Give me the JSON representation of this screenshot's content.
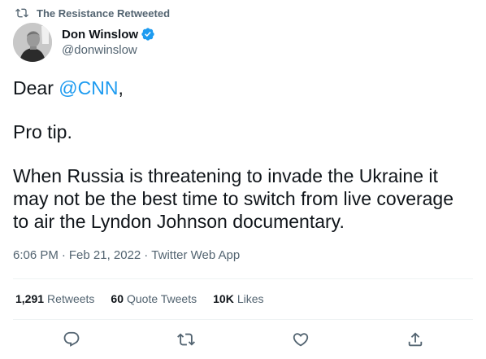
{
  "retweet_banner": {
    "icon": "retweet-icon",
    "text": "The Resistance Retweeted"
  },
  "author": {
    "avatar": "avatar-photo",
    "name": "Don Winslow",
    "verified_icon": "verified-badge-icon",
    "handle": "@donwinslow"
  },
  "tweet": {
    "line1_prefix": "Dear ",
    "line1_mention": "@CNN",
    "line1_suffix": ",",
    "paragraph2": "Pro tip.",
    "paragraph3": "When Russia is threatening to invade the Ukraine it may not be the best time to switch from live coverage to air the Lyndon Johnson documentary."
  },
  "meta": {
    "time": "6:06 PM",
    "separator": "·",
    "date": "Feb 21, 2022",
    "source": "Twitter Web App"
  },
  "stats": {
    "retweets_count": "1,291",
    "retweets_label": "Retweets",
    "quote_count": "60",
    "quote_label": "Quote Tweets",
    "likes_count": "10K",
    "likes_label": "Likes"
  },
  "actions": {
    "reply_icon": "reply-icon",
    "retweet_icon": "retweet-icon",
    "like_icon": "like-icon",
    "share_icon": "share-icon"
  },
  "colors": {
    "accent": "#1d9bf0",
    "text": "#0f1419",
    "muted": "#536471",
    "divider": "#eff3f4"
  }
}
